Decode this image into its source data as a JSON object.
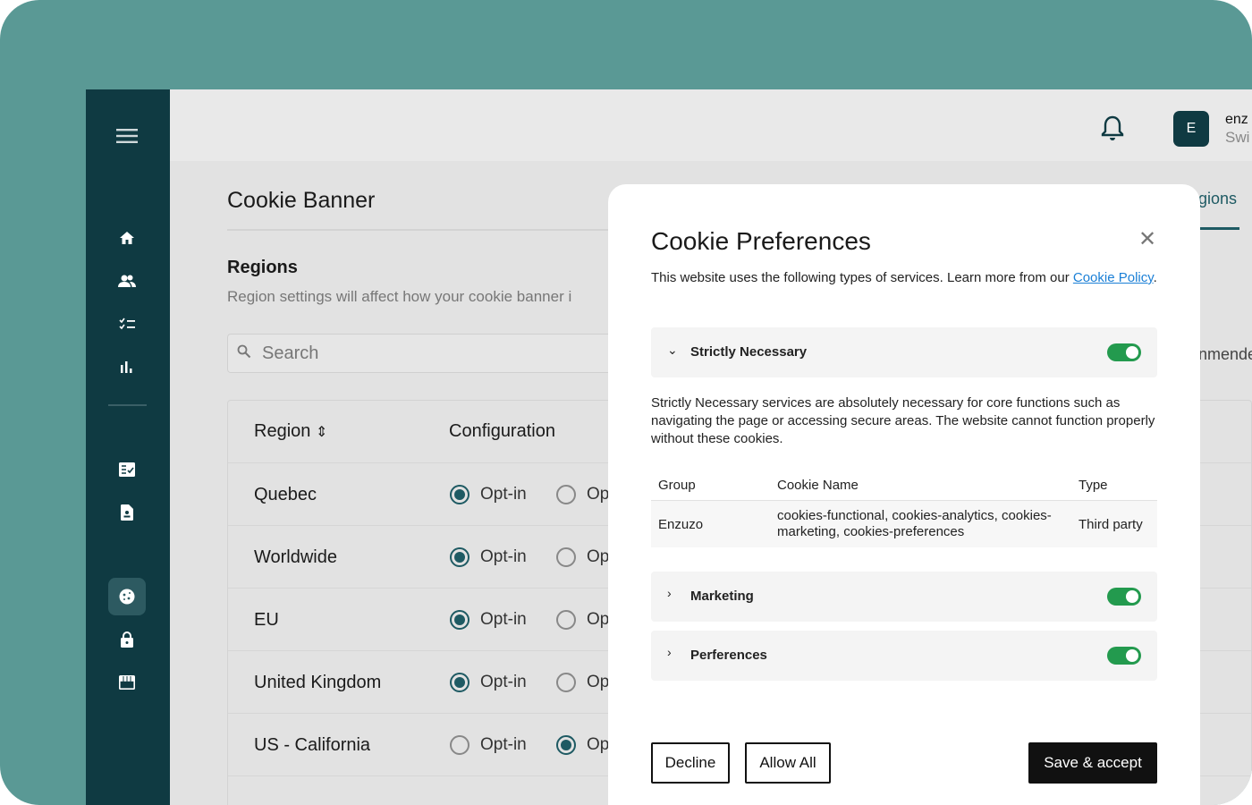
{
  "header": {
    "avatar_letter": "E",
    "user_name": "enz",
    "org": "Swi"
  },
  "page": {
    "title": "Cookie Banner",
    "section_title": "Regions",
    "section_desc": "Region settings will affect how your cookie banner i",
    "search_placeholder": "Search",
    "tab_partial": "gions",
    "recommended_partial": "nmende"
  },
  "table": {
    "headers": {
      "region": "Region",
      "configuration": "Configuration"
    },
    "rows": [
      {
        "region": "Quebec",
        "opt_in": "Opt-in",
        "opt_out": "Op",
        "selected": "opt_in"
      },
      {
        "region": "Worldwide",
        "opt_in": "Opt-in",
        "opt_out": "Op",
        "selected": "opt_in"
      },
      {
        "region": "EU",
        "opt_in": "Opt-in",
        "opt_out": "Op",
        "selected": "opt_in"
      },
      {
        "region": "United Kingdom",
        "opt_in": "Opt-in",
        "opt_out": "Op",
        "selected": "opt_in"
      },
      {
        "region": "US - California",
        "opt_in": "Opt-in",
        "opt_out": "Op",
        "selected": "opt_out"
      }
    ]
  },
  "modal": {
    "title": "Cookie Preferences",
    "desc": "This website uses the following types of services. Learn more from our ",
    "link": "Cookie Policy",
    "desc_end": ".",
    "sections": [
      {
        "label": "Strictly Necessary",
        "expanded": true,
        "enabled": true
      },
      {
        "label": "Marketing",
        "expanded": false,
        "enabled": true
      },
      {
        "label": "Perferences",
        "expanded": false,
        "enabled": true
      }
    ],
    "strict_desc": "Strictly Necessary services are absolutely necessary for core functions such as navigating the page or accessing secure areas. The website cannot function properly without these cookies.",
    "cookie_table": {
      "headers": [
        "Group",
        "Cookie Name",
        "Type"
      ],
      "rows": [
        {
          "group": "Enzuzo",
          "names": "cookies-functional, cookies-analytics, cookies-marketing, cookies-preferences",
          "type": "Third party"
        }
      ]
    },
    "buttons": {
      "decline": "Decline",
      "allow_all": "Allow All",
      "save": "Save & accept"
    }
  },
  "colors": {
    "sidebar": "#0f3a42",
    "accent": "#1e5a63",
    "toggle": "#239a4e",
    "link": "#1a7fd6",
    "backdrop": "#5a9995"
  }
}
